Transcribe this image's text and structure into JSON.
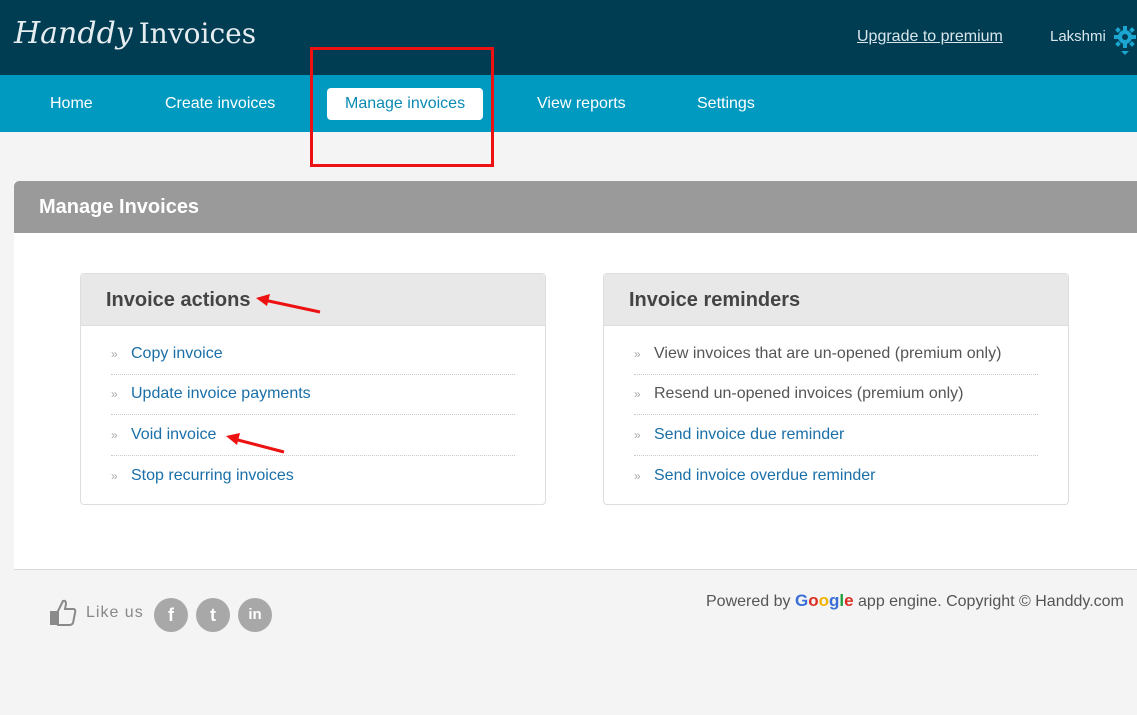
{
  "header": {
    "logo_script": "Handdy",
    "logo_word": "Invoices",
    "upgrade_label": "Upgrade to premium",
    "username": "Lakshmi"
  },
  "nav": {
    "items": [
      {
        "label": "Home"
      },
      {
        "label": "Create invoices"
      },
      {
        "label": "Manage invoices",
        "active": true
      },
      {
        "label": "View reports"
      },
      {
        "label": "Settings"
      }
    ]
  },
  "panel": {
    "title": "Manage Invoices"
  },
  "actions": {
    "title": "Invoice actions",
    "items": [
      {
        "label": "Copy invoice"
      },
      {
        "label": "Update invoice payments"
      },
      {
        "label": "Void invoice"
      },
      {
        "label": "Stop recurring invoices"
      }
    ]
  },
  "reminders": {
    "title": "Invoice reminders",
    "items": [
      {
        "label": "View invoices that are un-opened (premium only)",
        "premium": true
      },
      {
        "label": "Resend un-opened invoices (premium only)",
        "premium": true
      },
      {
        "label": "Send invoice due reminder"
      },
      {
        "label": "Send invoice overdue reminder"
      }
    ]
  },
  "footer": {
    "like_label": "Like us",
    "social": [
      {
        "icon": "facebook-icon",
        "glyph": "f"
      },
      {
        "icon": "twitter-icon",
        "glyph": "t"
      },
      {
        "icon": "linkedin-icon",
        "glyph": "in"
      }
    ],
    "powered_prefix": "Powered by",
    "google_letters": [
      "G",
      "o",
      "o",
      "g",
      "l",
      "e"
    ],
    "powered_suffix": "app engine. Copyright © Handdy.com"
  },
  "colors": {
    "topbar": "#003d52",
    "navbar": "#0099c0",
    "link": "#1a6fa8",
    "annotation": "#ee1111",
    "google": [
      "#3b6fd8",
      "#d93025",
      "#f2b300",
      "#3b6fd8",
      "#1e9e3e",
      "#d93025"
    ]
  }
}
